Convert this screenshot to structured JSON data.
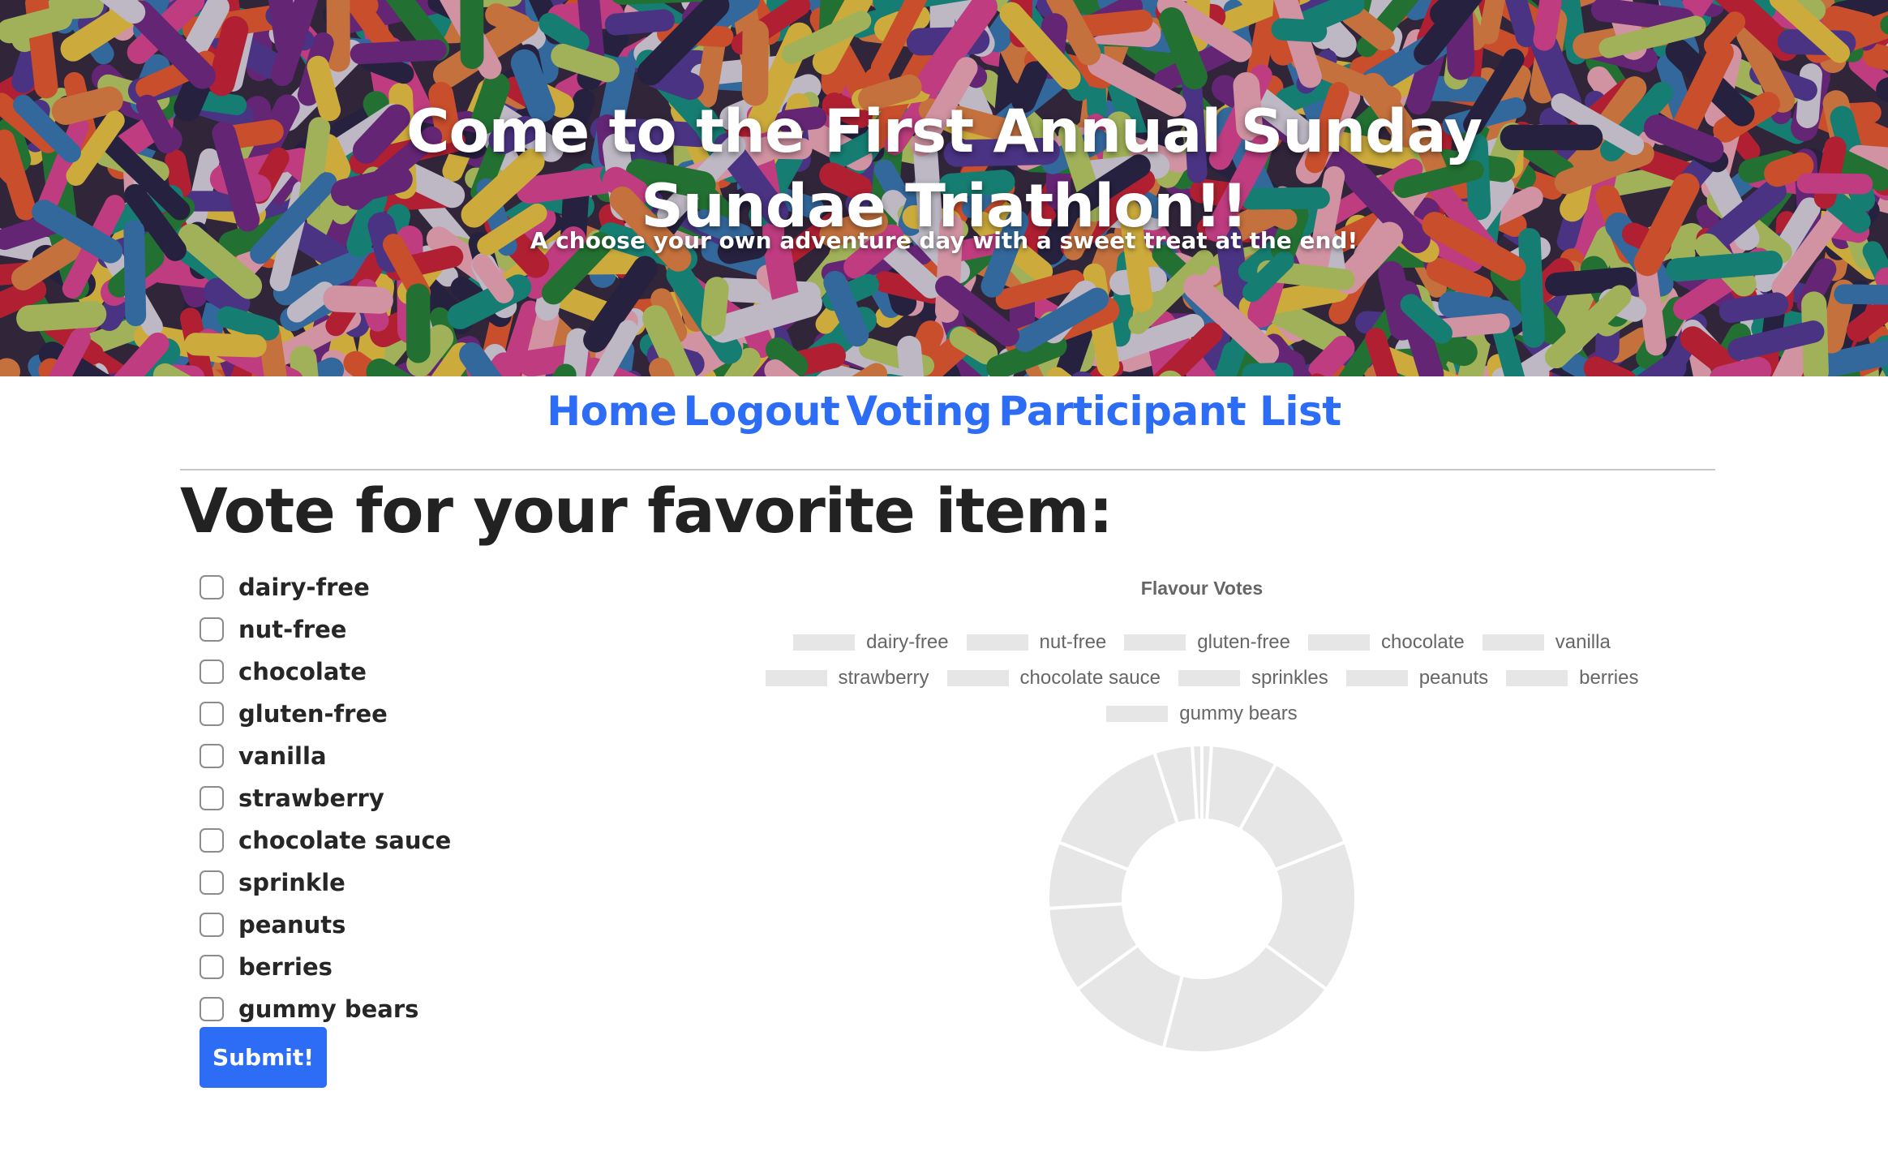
{
  "hero": {
    "title_line1": "Come to the First Annual Sunday",
    "title_line2": "Sundae Triathlon!!",
    "subtitle": "A choose your own adventure day with a sweet treat at the end!"
  },
  "nav": {
    "items": [
      {
        "label": "Home"
      },
      {
        "label": "Logout"
      },
      {
        "label": "Voting"
      },
      {
        "label": "Participant List"
      }
    ]
  },
  "vote": {
    "heading": "Vote for your favorite item:",
    "options": [
      {
        "label": "dairy-free",
        "checked": false
      },
      {
        "label": "nut-free",
        "checked": false
      },
      {
        "label": "chocolate",
        "checked": false
      },
      {
        "label": "gluten-free",
        "checked": false
      },
      {
        "label": "vanilla",
        "checked": false
      },
      {
        "label": "strawberry",
        "checked": false
      },
      {
        "label": "chocolate sauce",
        "checked": false
      },
      {
        "label": "sprinkle",
        "checked": false
      },
      {
        "label": "peanuts",
        "checked": false
      },
      {
        "label": "berries",
        "checked": false
      },
      {
        "label": "gummy bears",
        "checked": false
      }
    ],
    "submit_label": "Submit!"
  },
  "chart_data": {
    "type": "pie",
    "title": "Flavour Votes",
    "categories": [
      "dairy-free",
      "nut-free",
      "gluten-free",
      "chocolate",
      "vanilla",
      "strawberry",
      "chocolate sauce",
      "sprinkles",
      "peanuts",
      "berries",
      "gummy bears"
    ],
    "values": [
      1,
      7,
      11,
      16,
      19,
      11,
      9,
      7,
      14,
      4,
      1
    ],
    "legend_placement": "top",
    "slice_color": "#e6e6e6"
  },
  "colors": {
    "link": "#2d6df6",
    "button": "#2d6df6",
    "heading": "#222222",
    "chart_text": "#666666"
  }
}
